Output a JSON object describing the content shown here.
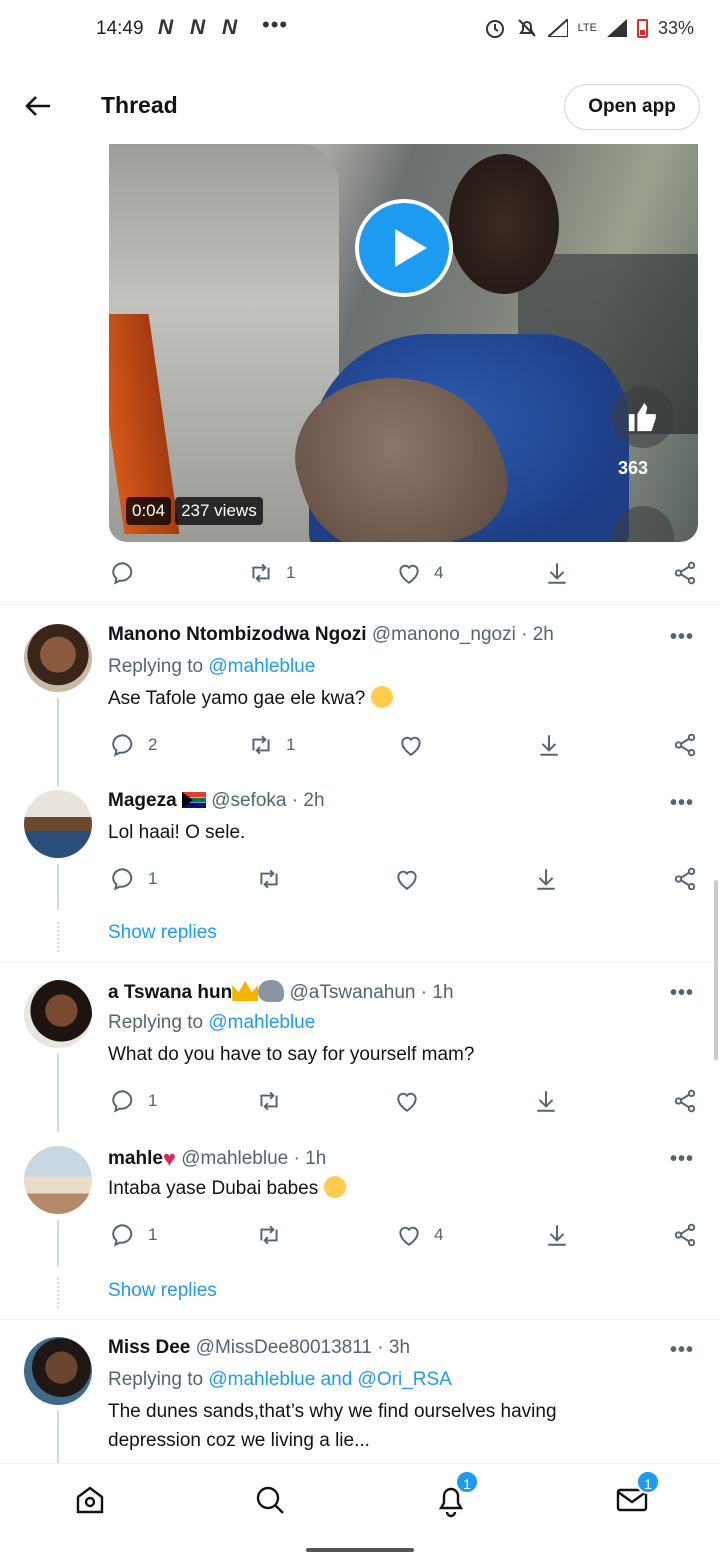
{
  "status_bar": {
    "time": "14:49",
    "notif_icons": [
      "N",
      "N",
      "N"
    ],
    "dots": "•••",
    "network": "LTE",
    "battery": "33%"
  },
  "header": {
    "title": "Thread",
    "open_app_label": "Open app"
  },
  "video": {
    "duration": "0:04",
    "views": "237 views",
    "like_count": "363"
  },
  "main_actions": {
    "retweets": "1",
    "likes": "4"
  },
  "tweets": [
    {
      "name": "Manono Ntombizodwa Ngozi",
      "handle": "@manono_ngozi",
      "time": "· 2h",
      "reply_prefix": "Replying to ",
      "reply_to": "@mahleblue",
      "text": "Ase Tafole yamo gae ele kwa?",
      "emoji": "thinking-face",
      "replies": "2",
      "retweets": "1",
      "likes": ""
    },
    {
      "name": "Mageza",
      "handle": "@sefoka",
      "time": "· 2h",
      "text": "Lol haai! O sele.",
      "replies": "1",
      "retweets": "",
      "likes": "",
      "show_replies": "Show replies"
    },
    {
      "name": "a Tswana hun",
      "handle": "@aTswanahun",
      "time": "· 1h",
      "reply_prefix": "Replying to ",
      "reply_to": "@mahleblue",
      "text": "What do you have to say for yourself mam?",
      "replies": "1",
      "retweets": "",
      "likes": ""
    },
    {
      "name": "mahle",
      "handle": "@mahleblue",
      "time": "· 1h",
      "text": "Intaba yase Dubai babes",
      "replies": "1",
      "retweets": "",
      "likes": "4",
      "show_replies": "Show replies"
    },
    {
      "name": "Miss Dee",
      "handle": "@MissDee80013811",
      "time": "· 3h",
      "reply_prefix": "Replying to ",
      "reply_to": "@mahleblue and @Ori_RSA",
      "text": "The dunes sands,that’s why we find ourselves having depression coz we living a lie..."
    }
  ],
  "more_label": "•••",
  "bottom_nav": {
    "notifications_badge": "1",
    "messages_badge": "1"
  },
  "colors": {
    "accent": "#1d9bf0",
    "muted": "#536471",
    "text": "#0f1419"
  }
}
